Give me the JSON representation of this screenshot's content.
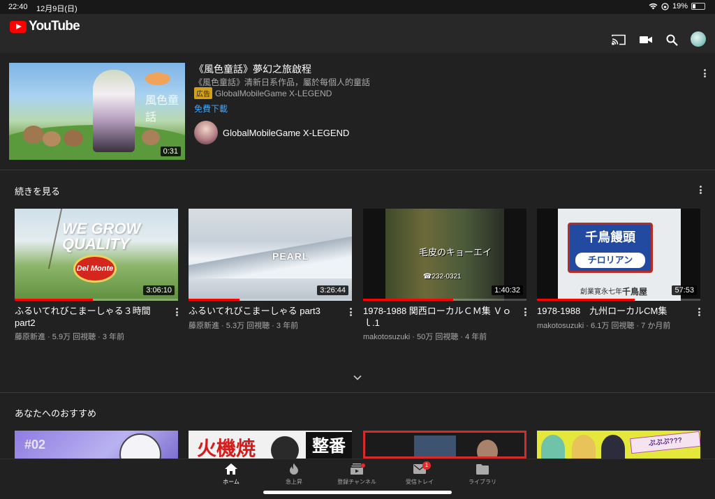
{
  "status_bar": {
    "time": "22:40",
    "date": "12月9日(日)",
    "battery": "19%"
  },
  "header": {
    "logo_text": "YouTube"
  },
  "ad": {
    "title": "《風色童話》夢幻之旅啟程",
    "description": "《風色童話》清新日系作品，屬於每個人的童話",
    "badge": "広告",
    "advertiser": "GlobalMobileGame X-LEGEND",
    "cta": "免費下載",
    "channel_name": "GlobalMobileGame X-LEGEND",
    "duration": "0:31",
    "thumb_text": "風色童話"
  },
  "continue_section": {
    "title": "続きを見る",
    "videos": [
      {
        "title": "ふるいてれびこまーしゃる３時間part2",
        "meta": "藤原新進 · 5.9万 回視聴 · 3 年前",
        "duration": "3:06:10",
        "progress": 0.48,
        "thumb_big": "WE GROW QUALITY",
        "thumb_badge": "Del Monte"
      },
      {
        "title": "ふるいてれびこまーしゃる part3",
        "meta": "藤原新進 · 5.3万 回視聴 · 3 年前",
        "duration": "3:26:44",
        "progress": 0.31,
        "thumb_text": "PEARL"
      },
      {
        "title": "1978-1988 関西ローカルＣＭ集 Ｖｏｌ.1",
        "meta": "makotosuzuki · 50万 回視聴 · 4 年前",
        "duration": "1:40:32",
        "progress": 0.55,
        "thumb_text_1": "毛皮のキョーエイ",
        "thumb_text_2": "☎232-0321"
      },
      {
        "title": "1978-1988　九州ローカルCM集",
        "meta": "makotosuzuki · 6.1万 回視聴 · 7 か月前",
        "duration": "57:53",
        "progress": 0.6,
        "thumb_text_1": "千鳥饅頭",
        "thumb_text_2": "チロリアン",
        "thumb_text_3": "創業寛永七年",
        "thumb_text_4": "千鳥屋"
      }
    ]
  },
  "recommended_section": {
    "title": "あなたへのおすすめ",
    "thumb_texts": [
      "#02",
      "火機焼",
      "整番",
      "ぷぷぷ???"
    ]
  },
  "bottom_nav": {
    "items": [
      {
        "label": "ホーム",
        "icon": "home-icon",
        "active": true
      },
      {
        "label": "急上昇",
        "icon": "trending-fire-icon"
      },
      {
        "label": "登録チャンネル",
        "icon": "subscriptions-icon"
      },
      {
        "label": "受信トレイ",
        "icon": "inbox-mail-icon",
        "badge": "1"
      },
      {
        "label": "ライブラリ",
        "icon": "library-folder-icon"
      }
    ]
  },
  "colors": {
    "background": "#212121",
    "header": "#282828",
    "accent_red": "#ff0000",
    "link_blue": "#3ea6ff"
  }
}
